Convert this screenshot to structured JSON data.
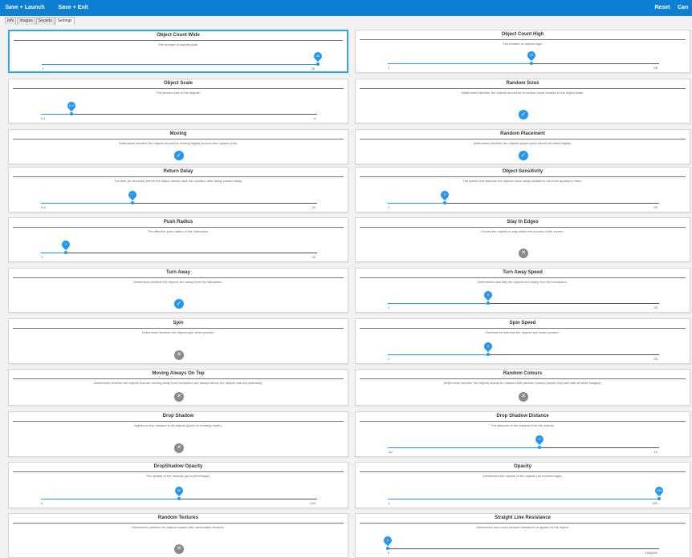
{
  "toolbar": {
    "save_launch": "Save + Launch",
    "save_exit": "Save + Exit",
    "reset": "Reset",
    "cancel": "Can"
  },
  "tabs": [
    "Info",
    "Images",
    "Sounds",
    "Settings"
  ],
  "colors": {
    "accent": "#2196f3",
    "toolbar": "#0f7fd3",
    "off": "#8a8a8a"
  },
  "settings": [
    {
      "title": "Object Count Wide",
      "desc": "The number of objects wide.",
      "type": "slider",
      "min": "1",
      "max": "25",
      "value": 25,
      "fraction": 1.0,
      "selected": true
    },
    {
      "title": "Object Count High",
      "desc": "The number of objects high.",
      "type": "slider",
      "min": "1",
      "max": "25",
      "value": 12,
      "fraction": 0.53
    },
    {
      "title": "Object Scale",
      "desc": "The percent size of the objects.",
      "type": "slider",
      "min": "0.1",
      "max": "4",
      "value": 0.9,
      "fraction": 0.11
    },
    {
      "title": "Random Sizes",
      "desc": "Determines whether the objects should be of random sizes relative to the object scale.",
      "type": "toggle",
      "checked": true
    },
    {
      "title": "Moving",
      "desc": "Determines whether the objects should be moving slightly around their spawn point.",
      "type": "toggle",
      "checked": true
    },
    {
      "title": "Random Placement",
      "desc": "Determines whether the objects spawn point should be offset slightly.",
      "type": "toggle",
      "checked": true
    },
    {
      "title": "Return Delay",
      "desc": "The time (in seconds) before the object moves back into position after being pushed away.",
      "type": "slider",
      "min": "0.5",
      "max": "20",
      "value": 7,
      "fraction": 0.33
    },
    {
      "title": "Object Sensitivity",
      "desc": "The speed and distance the objects move away relative to the force applied to them.",
      "type": "slider",
      "min": "1",
      "max": "20",
      "value": 5,
      "fraction": 0.21
    },
    {
      "title": "Push Radius",
      "desc": "The effective push radius of the interaction.",
      "type": "slider",
      "min": "1",
      "max": "22",
      "value": 2,
      "fraction": 0.09
    },
    {
      "title": "Stay In Edges",
      "desc": "Forces the objects to stay within the bounds of the screen.",
      "type": "toggle",
      "checked": false
    },
    {
      "title": "Turn Away",
      "desc": "Determines whether the objects turn away from the interaction.",
      "type": "toggle",
      "checked": true
    },
    {
      "title": "Turn Away Speed",
      "desc": "Determines how fast the objects turn away from the interaction.",
      "type": "slider",
      "min": "1",
      "max": "20",
      "value": 8,
      "fraction": 0.37
    },
    {
      "title": "Spin",
      "desc": "Determines whether the objects spin when pushed.",
      "type": "toggle",
      "checked": false
    },
    {
      "title": "Spin Speed",
      "desc": "Determines how fast the objects spin when pushed.",
      "type": "slider",
      "min": "1",
      "max": "20",
      "value": 8,
      "fraction": 0.37
    },
    {
      "title": "Moving Always On Top",
      "desc": "Determines whether the objects that are moving away from interaction are always above the objects that are stationary.",
      "type": "toggle",
      "checked": false
    },
    {
      "title": "Random Colours",
      "desc": "Determines whether the objects should be masked with random colours (works very well with all white images).",
      "type": "toggle",
      "checked": false
    },
    {
      "title": "Drop Shadow",
      "desc": "Applies a drop shadow to all objects (good for creating depth).",
      "type": "toggle",
      "checked": false
    },
    {
      "title": "Drop Shadow Distance",
      "desc": "The distance of the shadow from the objects.",
      "type": "slider",
      "min": "-12",
      "max": "12",
      "value": 0,
      "fraction": 0.56
    },
    {
      "title": "DropShadow Opacity",
      "desc": "The opacity of the shadow (as a percentage).",
      "type": "slider",
      "min": "0",
      "max": "100",
      "value": 50,
      "fraction": 0.5
    },
    {
      "title": "Opacity",
      "desc": "Determines the opacity of the objects (as a percentage).",
      "type": "slider",
      "min": "1",
      "max": "100",
      "value": 100,
      "fraction": 1.0
    },
    {
      "title": "Random Textures",
      "desc": "Determines whether the objects spawn with randomised textures.",
      "type": "toggle",
      "checked": false
    },
    {
      "title": "Straight Line Resistance",
      "desc": "Determines how much forward resistance is applied to the object.",
      "type": "slider",
      "min": "0",
      "max": "1000000",
      "value": 0,
      "fraction": 0.0
    }
  ]
}
